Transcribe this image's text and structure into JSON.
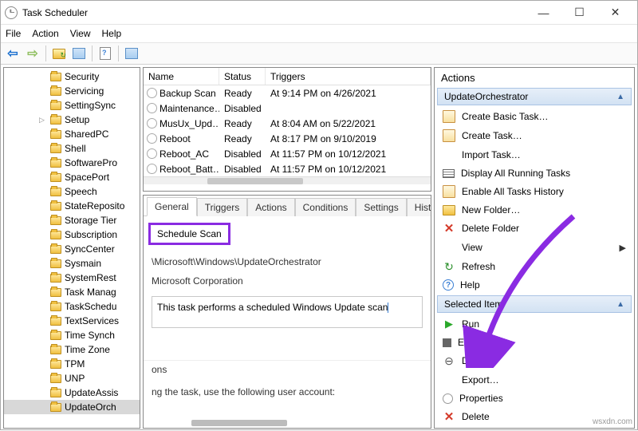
{
  "window": {
    "title": "Task Scheduler"
  },
  "menu": {
    "file": "File",
    "action": "Action",
    "view": "View",
    "help": "Help"
  },
  "tree": {
    "items": [
      {
        "label": "Security"
      },
      {
        "label": "Servicing"
      },
      {
        "label": "SettingSync"
      },
      {
        "label": "Setup",
        "expandable": true
      },
      {
        "label": "SharedPC"
      },
      {
        "label": "Shell"
      },
      {
        "label": "SoftwarePro"
      },
      {
        "label": "SpacePort"
      },
      {
        "label": "Speech"
      },
      {
        "label": "StateReposito"
      },
      {
        "label": "Storage Tier"
      },
      {
        "label": "Subscription"
      },
      {
        "label": "SyncCenter"
      },
      {
        "label": "Sysmain"
      },
      {
        "label": "SystemRest"
      },
      {
        "label": "Task Manag"
      },
      {
        "label": "TaskSchedu"
      },
      {
        "label": "TextServices"
      },
      {
        "label": "Time Synch"
      },
      {
        "label": "Time Zone"
      },
      {
        "label": "TPM"
      },
      {
        "label": "UNP"
      },
      {
        "label": "UpdateAssis"
      },
      {
        "label": "UpdateOrch",
        "selected": true
      }
    ]
  },
  "grid": {
    "headers": {
      "name": "Name",
      "status": "Status",
      "triggers": "Triggers"
    },
    "rows": [
      {
        "name": "Backup Scan",
        "status": "Ready",
        "triggers": "At 9:14 PM on 4/26/2021"
      },
      {
        "name": "Maintenance…",
        "status": "Disabled",
        "triggers": ""
      },
      {
        "name": "MusUx_Upd…",
        "status": "Ready",
        "triggers": "At 8:04 AM on 5/22/2021"
      },
      {
        "name": "Reboot",
        "status": "Ready",
        "triggers": "At 8:17 PM on 9/10/2019"
      },
      {
        "name": "Reboot_AC",
        "status": "Disabled",
        "triggers": "At 11:57 PM on 10/12/2021"
      },
      {
        "name": "Reboot_Batt…",
        "status": "Disabled",
        "triggers": "At 11:57 PM on 10/12/2021"
      }
    ]
  },
  "detail": {
    "tabs": {
      "general": "General",
      "triggers": "Triggers",
      "actions": "Actions",
      "conditions": "Conditions",
      "settings": "Settings",
      "history": "Hist"
    },
    "taskName": "Schedule Scan",
    "location": "\\Microsoft\\Windows\\UpdateOrchestrator",
    "author": "Microsoft Corporation",
    "description": "This task performs a scheduled Windows Update scan",
    "opt1": "ons",
    "opt2": "ng the task, use the following user account:"
  },
  "actions": {
    "title": "Actions",
    "groupA": {
      "header": "UpdateOrchestrator",
      "items": [
        {
          "icon": "doc",
          "label": "Create Basic Task…"
        },
        {
          "icon": "doc",
          "label": "Create Task…"
        },
        {
          "icon": "none",
          "label": "Import Task…"
        },
        {
          "icon": "grid",
          "label": "Display All Running Tasks"
        },
        {
          "icon": "doc",
          "label": "Enable All Tasks History"
        },
        {
          "icon": "folder",
          "label": "New Folder…"
        },
        {
          "icon": "x",
          "label": "Delete Folder"
        },
        {
          "icon": "none",
          "label": "View",
          "submenu": true
        },
        {
          "icon": "refresh",
          "label": "Refresh"
        },
        {
          "icon": "help",
          "label": "Help"
        }
      ]
    },
    "groupB": {
      "header": "Selected Item",
      "items": [
        {
          "icon": "play",
          "label": "Run"
        },
        {
          "icon": "stop",
          "label": "End"
        },
        {
          "icon": "down",
          "label": "Disable"
        },
        {
          "icon": "none",
          "label": "Export…"
        },
        {
          "icon": "clock",
          "label": "Properties"
        },
        {
          "icon": "x",
          "label": "Delete"
        }
      ]
    }
  },
  "watermark": "wsxdn.com"
}
